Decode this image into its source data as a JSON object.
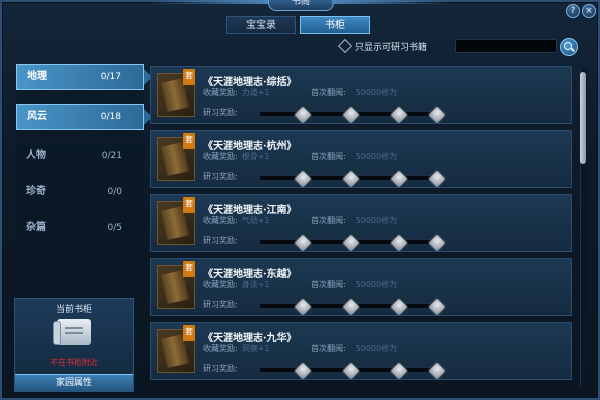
{
  "window": {
    "title": "书阁",
    "help_label": "?",
    "close_label": "×"
  },
  "tabs": [
    {
      "label": "宝宝录",
      "active": false
    },
    {
      "label": "书柜",
      "active": true
    }
  ],
  "filter": {
    "checkbox_label": "只显示可研习书籍",
    "search_value": ""
  },
  "categories": [
    {
      "name": "地理",
      "count": "0/17",
      "highlighted": true
    },
    {
      "name": "风云",
      "count": "0/18",
      "highlighted": true
    },
    {
      "name": "人物",
      "count": "0/21",
      "highlighted": false
    },
    {
      "name": "珍奇",
      "count": "0/0",
      "highlighted": false
    },
    {
      "name": "杂篇",
      "count": "0/5",
      "highlighted": false
    }
  ],
  "shelf": {
    "title": "当前书柜",
    "status": "不在书柜附近",
    "home_button": "家园属性"
  },
  "book_labels": {
    "reward": "收藏奖励:",
    "first_read": "首次翻阅:",
    "study": "研习奖励:",
    "badge": "套"
  },
  "books": [
    {
      "title": "《天涯地理志·综括》",
      "reward": "力道+1",
      "first_read": "50000修为"
    },
    {
      "title": "《天涯地理志·杭州》",
      "reward": "根骨+1",
      "first_read": "50000修为"
    },
    {
      "title": "《天涯地理志·江南》",
      "reward": "气劲+1",
      "first_read": "50000修为"
    },
    {
      "title": "《天涯地理志·东越》",
      "reward": "身法+1",
      "first_read": "50000修为"
    },
    {
      "title": "《天涯地理志·九华》",
      "reward": "洞察+1",
      "first_read": "50000修为"
    }
  ],
  "colors": {
    "accent": "#3f87c4",
    "warning": "#e03030",
    "badge": "#d07a12"
  }
}
